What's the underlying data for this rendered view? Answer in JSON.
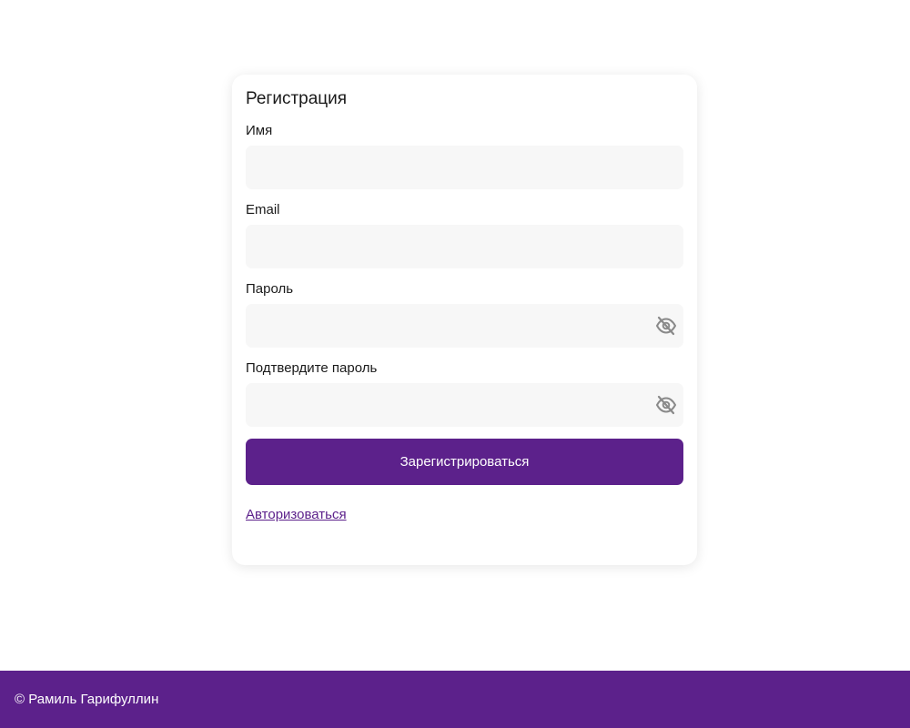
{
  "form": {
    "title": "Регистрация",
    "fields": {
      "name": {
        "label": "Имя",
        "value": "",
        "placeholder": ""
      },
      "email": {
        "label": "Email",
        "value": "",
        "placeholder": ""
      },
      "password": {
        "label": "Пароль",
        "value": "",
        "placeholder": "",
        "toggle_icon": "eye-off-icon"
      },
      "confirm_password": {
        "label": "Подтвердите пароль",
        "value": "",
        "placeholder": "",
        "toggle_icon": "eye-off-icon"
      }
    },
    "submit_label": "Зарегистрироваться",
    "login_link": "Авторизоваться"
  },
  "footer": {
    "text": "© Рамиль Гарифуллин"
  },
  "colors": {
    "accent": "#5c218b",
    "input_bg": "#f7f7f7",
    "icon": "#8a8a8a"
  }
}
